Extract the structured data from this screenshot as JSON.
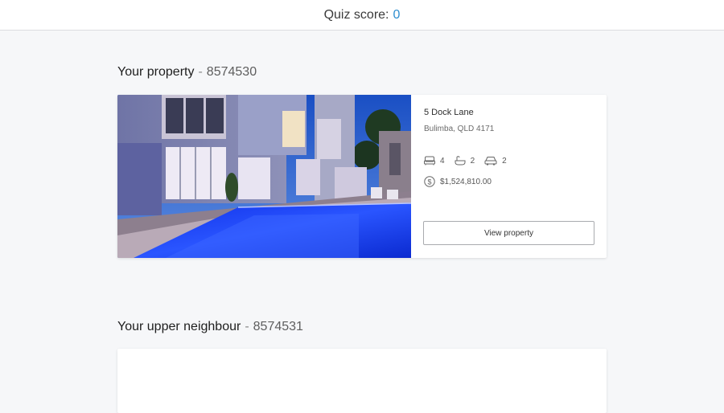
{
  "header": {
    "quiz_label": "Quiz score:",
    "quiz_score": "0"
  },
  "your_property": {
    "heading": "Your property",
    "separator": "-",
    "id": "8574530",
    "address_line1": "5 Dock Lane",
    "address_line2": "Bulimba, QLD 4171",
    "bedrooms": "4",
    "bathrooms": "2",
    "car_spaces": "2",
    "price": "$1,524,810.00",
    "view_button": "View property",
    "icons": [
      "bed-icon",
      "bath-icon",
      "car-icon",
      "dollar-icon"
    ]
  },
  "upper_neighbour": {
    "heading": "Your upper neighbour",
    "separator": "-",
    "id": "8574531"
  },
  "colors": {
    "accent": "#2f8fd0",
    "page_bg": "#f6f7f9",
    "card_bg": "#ffffff"
  }
}
